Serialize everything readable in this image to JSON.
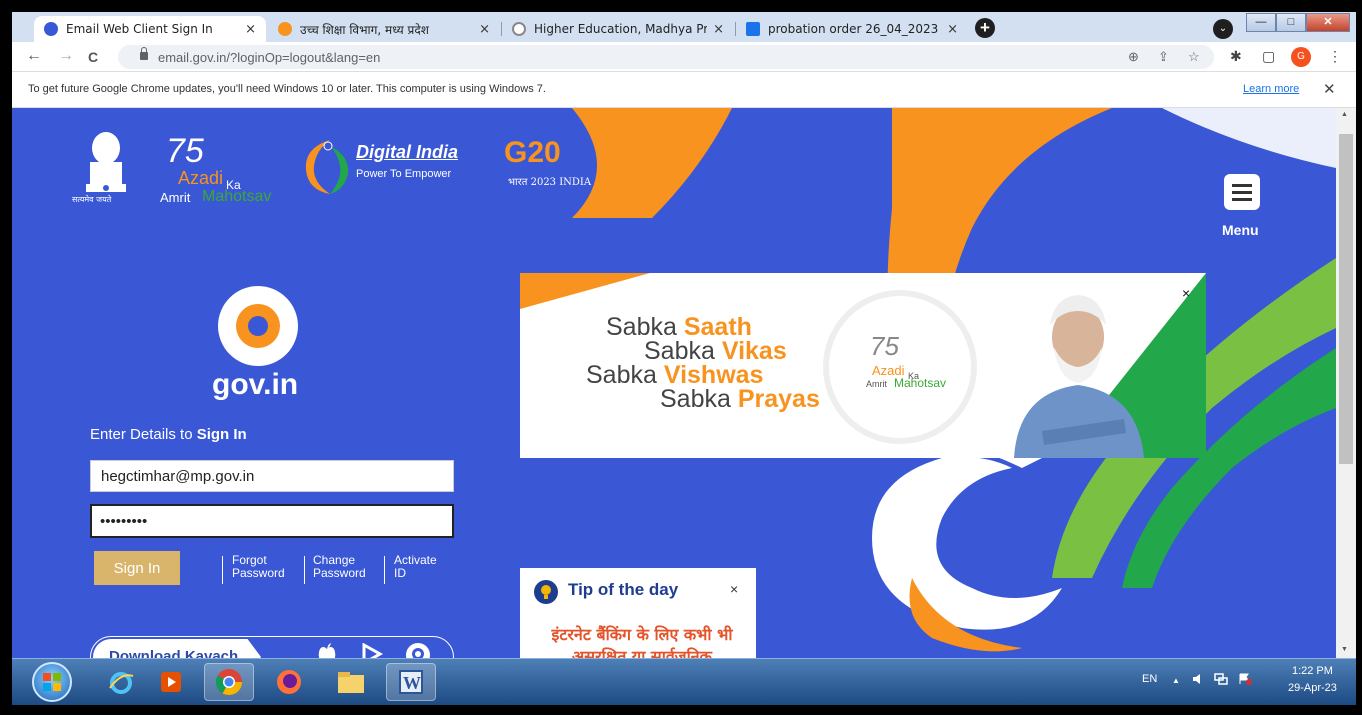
{
  "tabs": [
    {
      "title": "Email Web Client Sign In",
      "favicon": "gov-mail-icon",
      "color": "#3a57d6",
      "active": true
    },
    {
      "title": "उच्च शिक्षा विभाग, मध्य प्रदेश",
      "favicon": "mp-gov-icon",
      "color": "#f7931e",
      "active": false
    },
    {
      "title": "Higher Education, Madhya Prade",
      "favicon": "globe-icon",
      "color": "#888888",
      "active": false
    },
    {
      "title": "probation order 26_04_2023",
      "favicon": "document-icon",
      "color": "#1a73e8",
      "active": false
    }
  ],
  "new_tab_label": "+",
  "tab_close": "×",
  "tab_search_glyph": "⌄",
  "window_buttons": {
    "minimize": "—",
    "maximize": "□",
    "close": "✕"
  },
  "toolbar": {
    "back": "←",
    "forward": "→",
    "reload": "C",
    "url": "email.gov.in/?loginOp=logout&lang=en",
    "zoom_icon": "⊕",
    "share_icon": "⇪",
    "star_icon": "☆",
    "extensions_icon": "✱",
    "sidebar_icon": "▢",
    "profile_initial": "G",
    "more_icon": "⋮"
  },
  "infobar": {
    "message": "To get future Google Chrome updates, you'll need Windows 10 or later. This computer is using Windows 7.",
    "learn_more": "Learn more",
    "close": "✕"
  },
  "header": {
    "emblem_motto": "सत्यमेव जयते",
    "akam_75": "75",
    "akam_azadi": "Azadi",
    "akam_ka": "Ka",
    "akam_amrit": "Amrit",
    "akam_mahotsav": "Mahotsav",
    "digital_india_title": "Digital India",
    "digital_india_tagline": "Power To Empower",
    "g20_title": "G20",
    "g20_sub": "भारत 2023 INDIA",
    "menu_label": "Menu"
  },
  "login": {
    "logo_text": "gov.in",
    "heading_prefix": "Enter Details to ",
    "heading_bold": "Sign In",
    "email_value": "hegctimhar@mp.gov.in",
    "password_mask": "•••••••••",
    "sign_in": "Sign In",
    "links": [
      {
        "line1": "Forgot",
        "line2": "Password"
      },
      {
        "line1": "Change",
        "line2": "Password"
      },
      {
        "line1": "Activate",
        "line2": "ID"
      }
    ],
    "download_kavach": "Download Kavach",
    "kavach_platforms": [
      "apple-icon",
      "play-store-icon",
      "kavach-app-icon"
    ]
  },
  "banner": {
    "close": "×",
    "lines": [
      {
        "plain": "Sabka ",
        "bold": "Saath"
      },
      {
        "plain": "Sabka ",
        "bold": "Vikas"
      },
      {
        "plain": "Sabka ",
        "bold": "Vishwas"
      },
      {
        "plain": "Sabka ",
        "bold": "Prayas"
      }
    ],
    "akam_75": "75",
    "akam_azadi": "Azadi",
    "akam_ka": "Ka",
    "akam_amrit": "Amrit",
    "akam_mahotsav": "Mahotsav"
  },
  "tip": {
    "title": "Tip of the day",
    "close": "×",
    "body": "इंटरनेट बैंकिंग के लिए कभी भी असुरक्षित या सार्वजनिक"
  },
  "taskbar": {
    "apps": [
      "internet-explorer-icon",
      "media-center-icon",
      "chrome-icon",
      "firefox-icon",
      "file-explorer-icon",
      "word-icon"
    ],
    "language": "EN",
    "tray_up": "▲",
    "time": "1:22 PM",
    "date": "29-Apr-23"
  },
  "colors": {
    "page_bg": "#3a57d6",
    "saffron": "#f7931e",
    "green": "#22a84a",
    "sign_in_btn": "#d9b56c"
  }
}
